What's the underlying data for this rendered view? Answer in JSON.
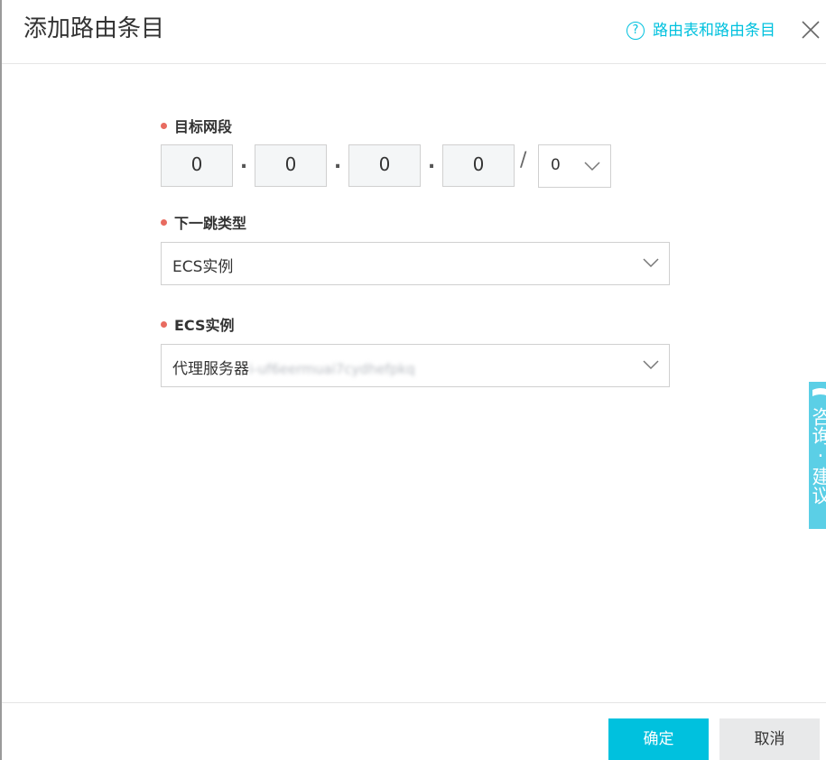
{
  "dialog": {
    "title": "添加路由条目",
    "help_link": "路由表和路由条目",
    "help_icon": "question-circle-icon",
    "close_icon": "close-icon"
  },
  "form": {
    "destination": {
      "label": "目标网段",
      "octets": [
        "0",
        "0",
        "0",
        "0"
      ],
      "separator": ".",
      "slash": "/",
      "mask_value": "0"
    },
    "next_hop_type": {
      "label": "下一跳类型",
      "value": "ECS实例"
    },
    "ecs_instance": {
      "label": "ECS实例",
      "value_prefix": "代理服务器",
      "value_blurred": "i-uf6eermuai7cydhefpkq"
    }
  },
  "feedback": {
    "label": "咨询·建议",
    "icon": "feedback-icon"
  },
  "footer": {
    "ok_label": "确定",
    "cancel_label": "取消"
  },
  "colors": {
    "accent": "#00c1de",
    "required": "#e86b60",
    "feedback_tab": "#5bcfe6"
  }
}
